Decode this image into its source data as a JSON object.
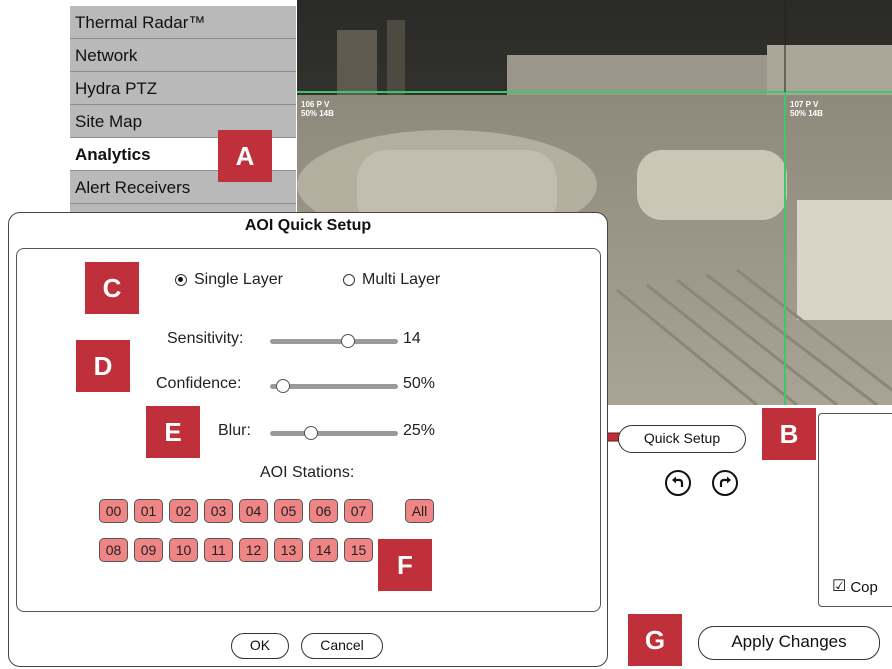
{
  "nav": {
    "items": [
      {
        "label": "Thermal Radar™"
      },
      {
        "label": "Network"
      },
      {
        "label": "Hydra PTZ"
      },
      {
        "label": "Site Map"
      },
      {
        "label": "Analytics",
        "active": true
      },
      {
        "label": "Alert Receivers"
      }
    ]
  },
  "camera": {
    "overlay_left": {
      "line1": "106 P V",
      "line2": "50% 14B"
    },
    "overlay_right": {
      "line1": "107 P V",
      "line2": "50% 14B"
    }
  },
  "markers": {
    "a": "A",
    "b": "B",
    "c": "C",
    "d": "D",
    "e": "E",
    "f": "F",
    "g": "G"
  },
  "dialog": {
    "title": "AOI Quick Setup",
    "layer": {
      "single": "Single Layer",
      "multi": "Multi Layer",
      "selected": "single"
    },
    "sensitivity": {
      "label": "Sensitivity:",
      "value": "14",
      "level": 0.62
    },
    "confidence": {
      "label": "Confidence:",
      "value": "50%",
      "level": 0.05
    },
    "blur": {
      "label": "Blur:",
      "value": "25%",
      "level": 0.3
    },
    "stations_title": "AOI Stations:",
    "stations_row1": [
      "00",
      "01",
      "02",
      "03",
      "04",
      "05",
      "06",
      "07"
    ],
    "stations_all": "All",
    "stations_row2": [
      "08",
      "09",
      "10",
      "11",
      "12",
      "13",
      "14",
      "15"
    ],
    "ok": "OK",
    "cancel": "Cancel"
  },
  "right": {
    "quick_setup": "Quick Setup",
    "copy_label": "Cop",
    "apply": "Apply Changes"
  },
  "colors": {
    "marker": "#c0303a",
    "station": "#f08585",
    "aoi_line": "#3ec66a",
    "arrow": "#c0303a"
  }
}
